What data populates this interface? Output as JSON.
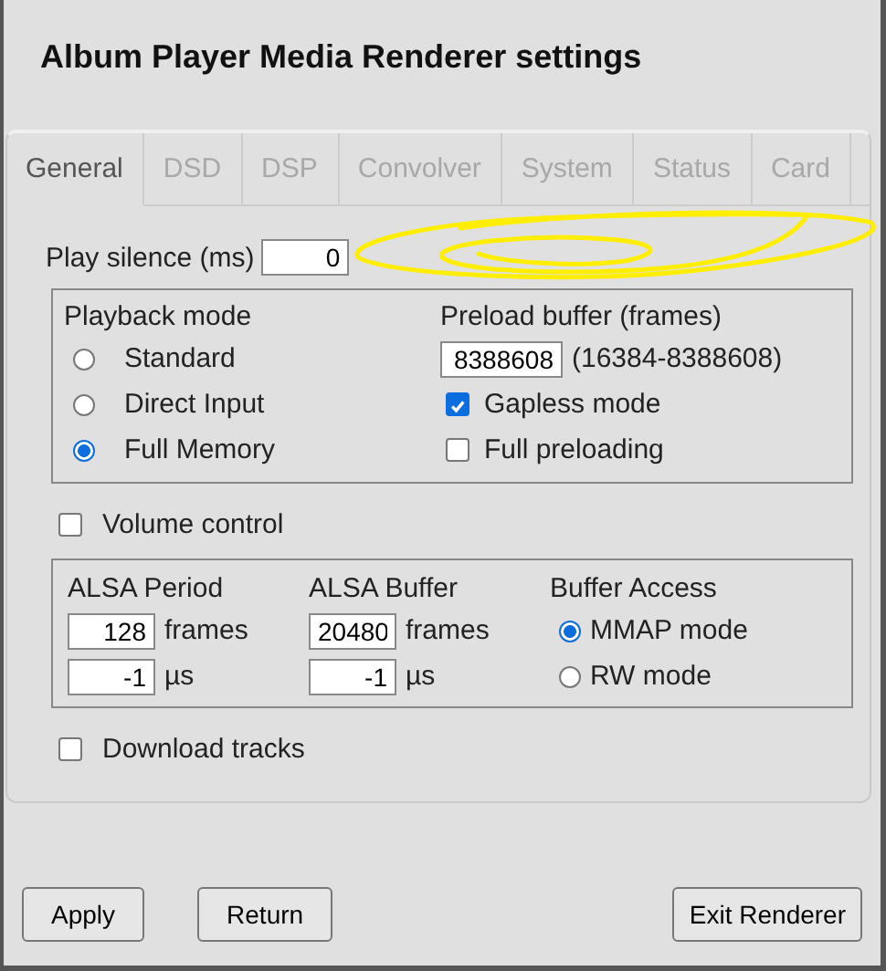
{
  "window": {
    "title": "Album Player Media Renderer settings"
  },
  "tabs": [
    {
      "label": "General",
      "selected": true
    },
    {
      "label": "DSD",
      "selected": false
    },
    {
      "label": "DSP",
      "selected": false
    },
    {
      "label": "Convolver",
      "selected": false
    },
    {
      "label": "System",
      "selected": false
    },
    {
      "label": "Status",
      "selected": false
    },
    {
      "label": "Card",
      "selected": false
    }
  ],
  "play_silence": {
    "label": "Play silence (ms)",
    "value": "0"
  },
  "playback_mode": {
    "label": "Playback mode",
    "options": [
      {
        "label": "Standard",
        "selected": false
      },
      {
        "label": "Direct Input",
        "selected": false
      },
      {
        "label": "Full Memory",
        "selected": true
      }
    ]
  },
  "preload_buffer": {
    "label": "Preload buffer (frames)",
    "value": "8388608",
    "range": "(16384-8388608)"
  },
  "preload_options": [
    {
      "label": "Gapless mode",
      "checked": true
    },
    {
      "label": "Full preloading",
      "checked": false
    }
  ],
  "volume_control": {
    "label": "Volume control",
    "checked": false
  },
  "alsa": [
    {
      "label": "ALSA Period",
      "value": "128",
      "unit": "frames",
      "time_value": "-1",
      "time_unit": "µs"
    },
    {
      "label": "ALSA Buffer",
      "value": "20480",
      "unit": "frames",
      "time_value": "-1",
      "time_unit": "µs"
    }
  ],
  "buffer_access": {
    "label": "Buffer Access",
    "options": [
      {
        "label": "MMAP mode",
        "selected": true
      },
      {
        "label": "RW mode",
        "selected": false
      }
    ]
  },
  "download_tracks": {
    "label": "Download tracks",
    "checked": false
  },
  "left_buttons": [
    "Apply",
    "Return"
  ],
  "right_buttons": [
    "Exit Renderer"
  ]
}
